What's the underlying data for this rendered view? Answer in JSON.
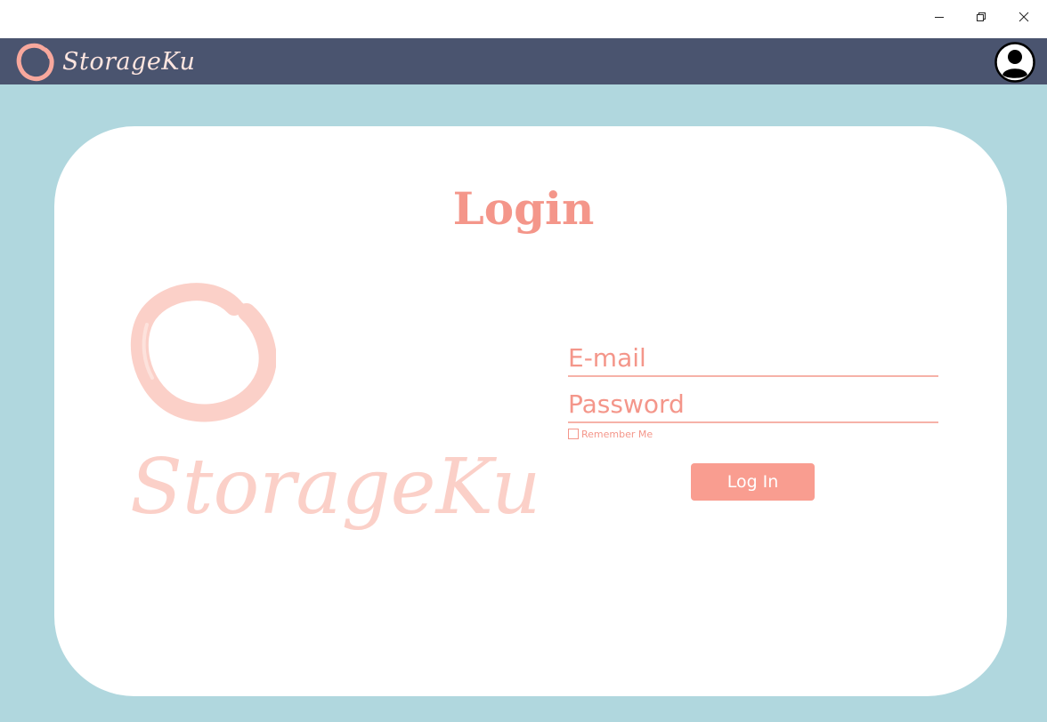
{
  "window": {
    "controls": {
      "minimize": "minimize-icon",
      "maximize": "restore-icon",
      "close": "close-icon"
    }
  },
  "header": {
    "app_name": "StorageKu",
    "logo_icon": "brush-circle-icon",
    "profile_icon": "user-circle-icon"
  },
  "main": {
    "title": "Login",
    "watermark_name": "StorageKu",
    "form": {
      "email_placeholder": "E-mail",
      "email_value": "",
      "password_placeholder": "Password",
      "password_value": "",
      "remember_label": "Remember Me",
      "remember_checked": false,
      "submit_label": "Log In"
    }
  },
  "colors": {
    "header_bg": "#4a546f",
    "page_bg": "#b0d7de",
    "accent": "#f4968a",
    "button_bg": "#f99d90",
    "logo_light": "#fbd0c8"
  }
}
